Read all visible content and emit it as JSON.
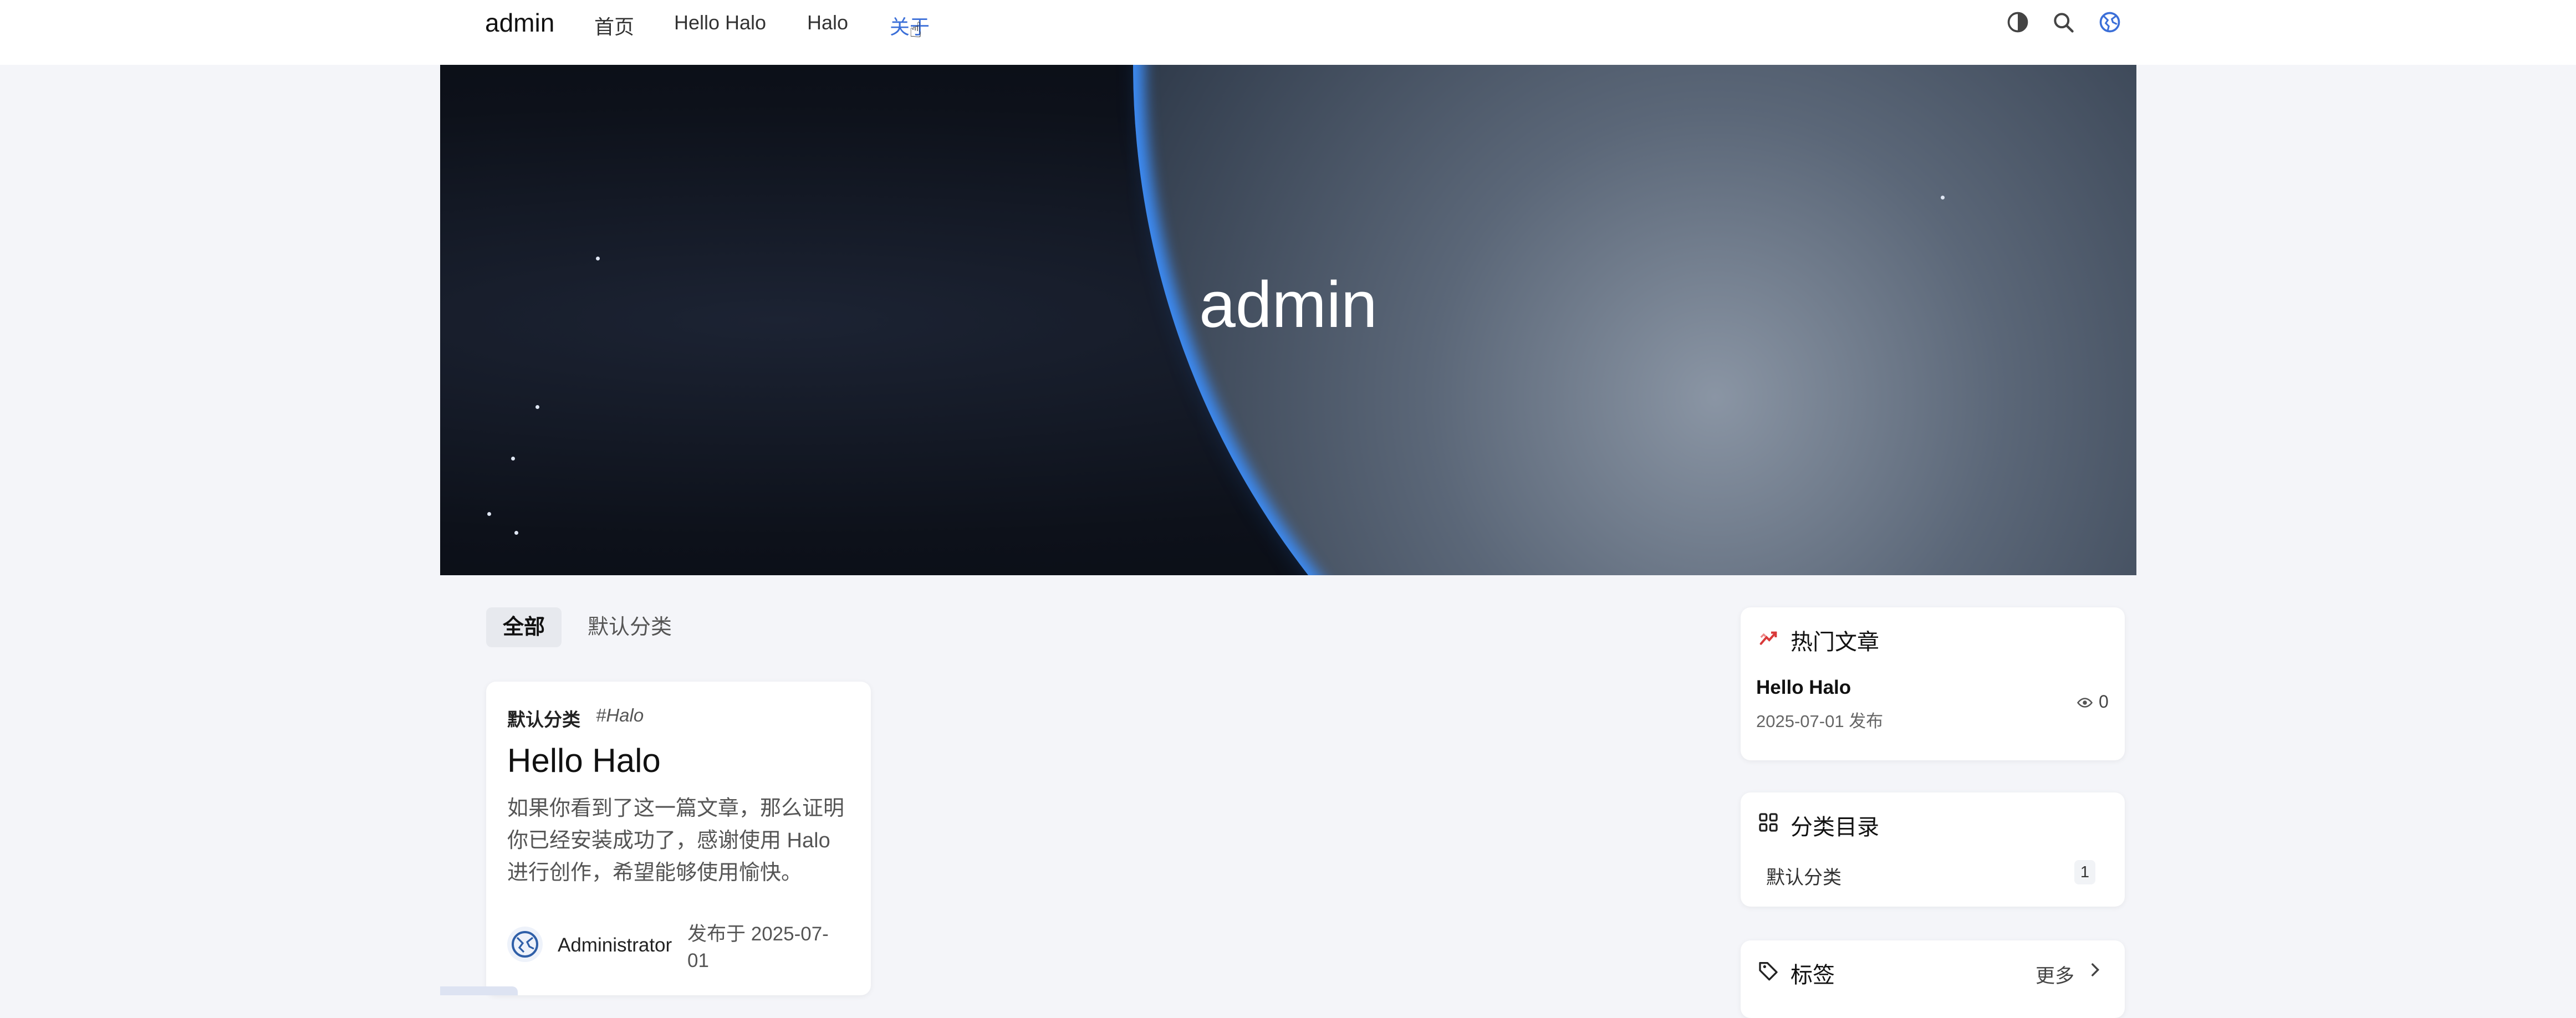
{
  "header": {
    "brand": "admin",
    "nav": [
      "首页",
      "Hello Halo",
      "Halo",
      "关于"
    ],
    "active_index": 3,
    "icons": [
      "theme-toggle-icon",
      "search-icon",
      "globe-icon"
    ],
    "accent_color": "#3b6fd8"
  },
  "hero": {
    "title": "admin"
  },
  "category_tabs": [
    "全部",
    "默认分类"
  ],
  "post": {
    "category": "默认分类",
    "tag": "#Halo",
    "title": "Hello Halo",
    "excerpt": "如果你看到了这一篇文章，那么证明你已经安装成功了，感谢使用 Halo 进行创作，希望能够使用愉快。",
    "author": "Administrator",
    "date": "发布于 2025-07-01"
  },
  "sidebar": {
    "hot": {
      "title": "热门文章",
      "items": [
        {
          "title": "Hello Halo",
          "date": "2025-07-01 发布",
          "views": "0"
        }
      ]
    },
    "categories": {
      "title": "分类目录",
      "items": [
        {
          "name": "默认分类",
          "count": "1"
        }
      ]
    },
    "tags": {
      "title": "标签",
      "more": "更多"
    }
  }
}
